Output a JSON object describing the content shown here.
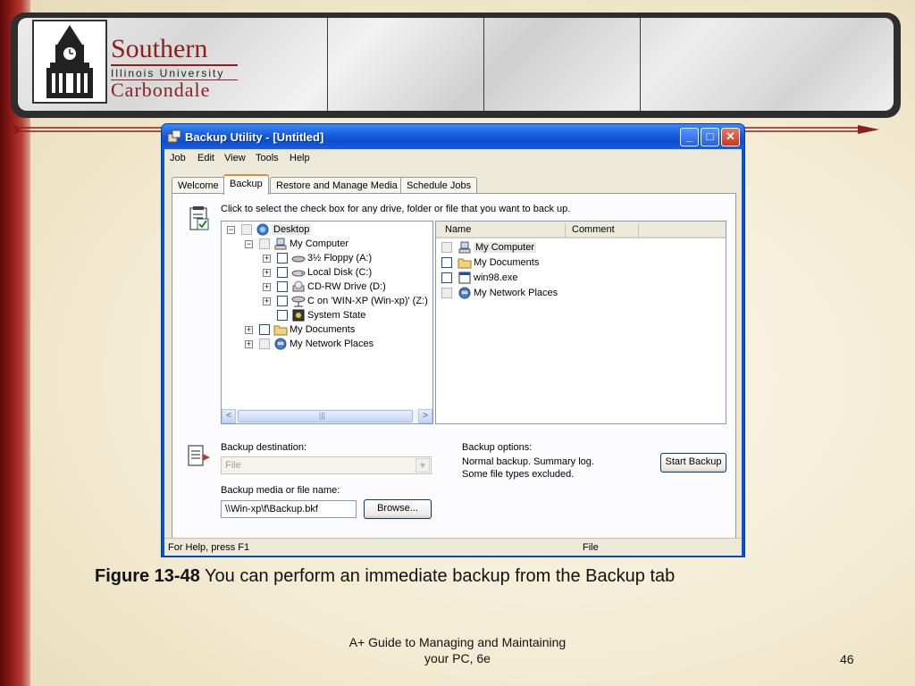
{
  "logo": {
    "line1": "Southern",
    "line2": "Illinois University",
    "line3": "Carbondale"
  },
  "window": {
    "title": "Backup Utility - [Untitled]",
    "minimize_label": "_",
    "maximize_label": "□",
    "close_label": "✕"
  },
  "menu": [
    "Job",
    "Edit",
    "View",
    "Tools",
    "Help"
  ],
  "tabs": [
    "Welcome",
    "Backup",
    "Restore and Manage Media",
    "Schedule Jobs"
  ],
  "active_tab": "Backup",
  "instruction": "Click to select the check box for any drive, folder or file that you want to back up.",
  "tree": [
    {
      "label": "Desktop",
      "expander": "−",
      "checkbox": "gray",
      "icon": "desktop-icon"
    },
    {
      "label": "My Computer",
      "expander": "−",
      "checkbox": "gray",
      "icon": "computer-icon"
    },
    {
      "label": "3½ Floppy (A:)",
      "expander": "+",
      "checkbox": "normal",
      "icon": "floppy-icon"
    },
    {
      "label": "Local Disk (C:)",
      "expander": "+",
      "checkbox": "normal",
      "icon": "disk-icon"
    },
    {
      "label": "CD-RW Drive (D:)",
      "expander": "+",
      "checkbox": "normal",
      "icon": "cd-icon"
    },
    {
      "label": "C on 'WIN-XP (Win-xp)' (Z:)",
      "expander": "+",
      "checkbox": "normal",
      "icon": "network-drive-icon"
    },
    {
      "label": "System State",
      "expander": "",
      "checkbox": "normal",
      "icon": "system-state-icon"
    },
    {
      "label": "My Documents",
      "expander": "+",
      "checkbox": "normal",
      "icon": "folder-icon"
    },
    {
      "label": "My Network Places",
      "expander": "+",
      "checkbox": "gray",
      "icon": "network-icon"
    }
  ],
  "list": {
    "columns": [
      "Name",
      "Comment"
    ],
    "rows": [
      {
        "name": "My Computer",
        "checkbox": "gray",
        "icon": "computer-icon"
      },
      {
        "name": "My Documents",
        "checkbox": "normal",
        "icon": "folder-icon"
      },
      {
        "name": "win98.exe",
        "checkbox": "normal",
        "icon": "exe-icon"
      },
      {
        "name": "My Network Places",
        "checkbox": "gray",
        "icon": "network-icon"
      }
    ]
  },
  "scroll_left": "<",
  "scroll_right": ">",
  "scroll_grip": "|||",
  "backup_destination_label": "Backup destination:",
  "backup_destination_value": "File",
  "backup_media_label": "Backup media or file name:",
  "backup_media_value": "\\\\Win-xp\\f\\Backup.bkf",
  "browse_label": "Browse...",
  "options": {
    "title": "Backup options:",
    "line1": "Normal backup.  Summary log.",
    "line2": "Some file types excluded."
  },
  "start_backup_label": "Start Backup",
  "status": {
    "left": "For Help, press F1",
    "right": "File"
  },
  "caption": {
    "figure": "Figure 13-48",
    "text": " You can perform an immediate backup from the Backup tab"
  },
  "footer": {
    "line1": "A+ Guide to Managing and Maintaining",
    "line2": "your PC, 6e"
  },
  "page_number": "46",
  "colors": {
    "accent_red": "#8a1f1d",
    "xp_blue": "#0a52d4",
    "tab_highlight": "#e68b2c"
  }
}
